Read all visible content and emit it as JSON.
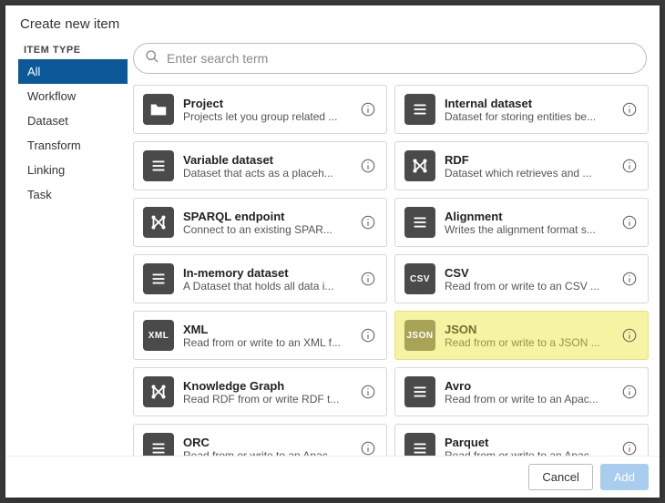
{
  "dialog": {
    "title": "Create new item"
  },
  "sidebar": {
    "heading": "ITEM TYPE",
    "items": [
      {
        "label": "All",
        "active": true
      },
      {
        "label": "Workflow",
        "active": false
      },
      {
        "label": "Dataset",
        "active": false
      },
      {
        "label": "Transform",
        "active": false
      },
      {
        "label": "Linking",
        "active": false
      },
      {
        "label": "Task",
        "active": false
      }
    ]
  },
  "search": {
    "placeholder": "Enter search term",
    "value": ""
  },
  "cards": [
    {
      "icon": "folder",
      "title": "Project",
      "desc": "Projects let you group related ...",
      "highlight": false
    },
    {
      "icon": "lines",
      "title": "Internal dataset",
      "desc": "Dataset for storing entities be...",
      "highlight": false
    },
    {
      "icon": "lines",
      "title": "Variable dataset",
      "desc": "Dataset that acts as a placeh...",
      "highlight": false
    },
    {
      "icon": "graph",
      "title": "RDF",
      "desc": "Dataset which retrieves and ...",
      "highlight": false
    },
    {
      "icon": "graph",
      "title": "SPARQL endpoint",
      "desc": "Connect to an existing SPAR...",
      "highlight": false
    },
    {
      "icon": "lines",
      "title": "Alignment",
      "desc": "Writes the alignment format s...",
      "highlight": false
    },
    {
      "icon": "lines",
      "title": "In-memory dataset",
      "desc": "A Dataset that holds all data i...",
      "highlight": false
    },
    {
      "icon": "csv",
      "title": "CSV",
      "desc": "Read from or write to an CSV ...",
      "highlight": false
    },
    {
      "icon": "xml",
      "title": "XML",
      "desc": "Read from or write to an XML f...",
      "highlight": false
    },
    {
      "icon": "json",
      "title": "JSON",
      "desc": "Read from or write to a JSON ...",
      "highlight": true
    },
    {
      "icon": "graph",
      "title": "Knowledge Graph",
      "desc": "Read RDF from or write RDF t...",
      "highlight": false
    },
    {
      "icon": "lines",
      "title": "Avro",
      "desc": "Read from or write to an Apac...",
      "highlight": false
    },
    {
      "icon": "lines",
      "title": "ORC",
      "desc": "Read from or write to an Apac...",
      "highlight": false
    },
    {
      "icon": "lines",
      "title": "Parquet",
      "desc": "Read from or write to an Apac...",
      "highlight": false
    }
  ],
  "footer": {
    "cancel_label": "Cancel",
    "add_label": "Add"
  },
  "icon_badges": {
    "csv": "CSV",
    "xml": "XML",
    "json": "JSON"
  }
}
